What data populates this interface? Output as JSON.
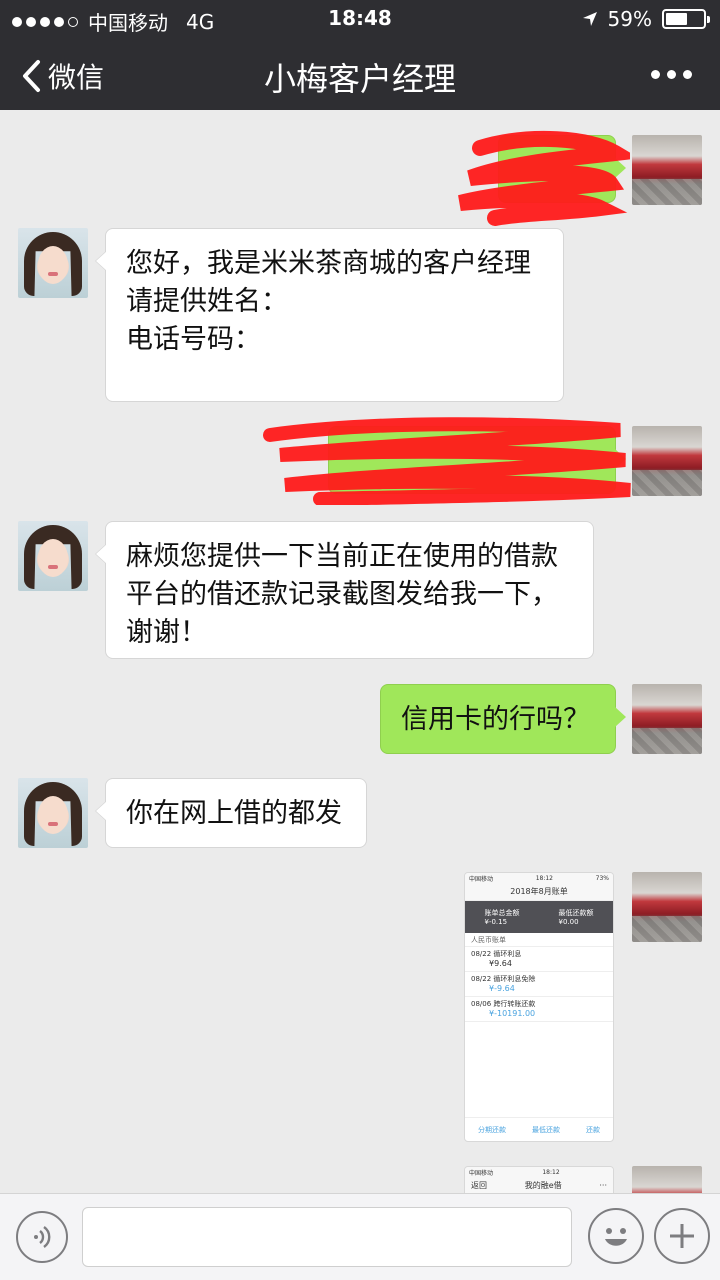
{
  "status_bar": {
    "carrier": "中国移动",
    "network": "4G",
    "time": "18:48",
    "battery": "59%",
    "battery_level": 0.59
  },
  "nav": {
    "back_label": "微信",
    "title": "小梅客户经理",
    "more_icon": "more-dots-icon"
  },
  "messages": [
    {
      "from": "me",
      "type": "text",
      "redacted": true
    },
    {
      "from": "manager",
      "type": "text",
      "text": "您好，我是米米茶商城的客户经理\n请提供姓名：\n电话号码：\n"
    },
    {
      "from": "me",
      "type": "text",
      "redacted": true
    },
    {
      "from": "manager",
      "type": "text",
      "text": "麻烦您提供一下当前正在使用的借款\n平台的借还款记录截图发给我一下，\n谢谢！"
    },
    {
      "from": "me",
      "type": "text",
      "text": "信用卡的行吗？"
    },
    {
      "from": "manager",
      "type": "text",
      "text": "你在网上借的都发"
    },
    {
      "from": "me",
      "type": "image",
      "screenshot": {
        "carrier": "中国移动",
        "network": "4G",
        "time": "18:12",
        "battery": "73%",
        "title": "2018年8月账单",
        "stat1_label": "账单总金额",
        "stat1_value": "¥-0.15",
        "stat2_label": "最低还款额",
        "stat2_value": "¥0.00",
        "list_header": "人民币账单",
        "rows": [
          {
            "date": "08/22",
            "desc": "循环利息",
            "amount": "¥9.64"
          },
          {
            "date": "08/22",
            "desc": "循环利息免除",
            "amount": "¥-9.64"
          },
          {
            "date": "08/06",
            "desc": "跨行转账还款",
            "amount": "¥-10191.00"
          }
        ],
        "footer": [
          "分期还款",
          "最低还款",
          "还款"
        ]
      }
    },
    {
      "from": "me",
      "type": "image",
      "screenshot": {
        "carrier": "中国移动",
        "network": "4G",
        "time": "18:12",
        "back": "返回",
        "title": "我的融e借"
      }
    }
  ],
  "input": {
    "placeholder": "",
    "voice_icon": "voice-icon",
    "emoji_icon": "emoji-icon",
    "plus_icon": "plus-icon"
  },
  "colors": {
    "nav_bg": "#2e2e32",
    "chat_bg": "#ebebeb",
    "bubble_out": "#a0e75a",
    "bubble_in": "#ffffff",
    "redaction": "#ff1a1a"
  }
}
